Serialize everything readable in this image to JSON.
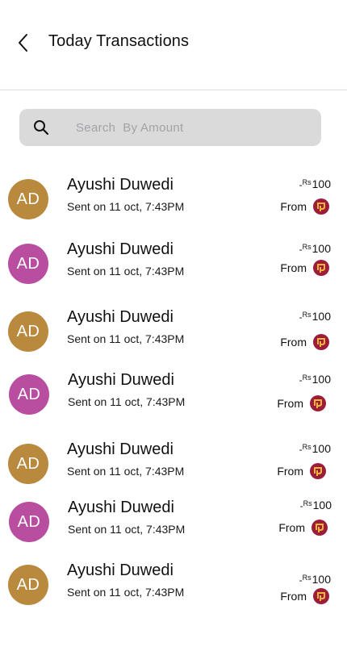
{
  "header": {
    "title": "Today Transactions"
  },
  "search": {
    "placeholder": "Search  By Amount"
  },
  "colors": {
    "avatar_gold": "#b98a3e",
    "avatar_magenta": "#b94ea1",
    "search_bg": "#dadada",
    "bank_logo_red": "#9c1d3a",
    "bank_logo_yellow": "#f0b43c"
  },
  "transactions": [
    {
      "initials": "AD",
      "name": "Ayushi Duwedi",
      "subtitle": "Sent on 11 oct, 7:43PM",
      "sign": "-",
      "currency": "Rs",
      "amount": "100",
      "from_label": "From",
      "avatar_color": "gold",
      "bank_icon": "bank-logo-icon"
    },
    {
      "initials": "AD",
      "name": "Ayushi Duwedi",
      "subtitle": "Sent on 11 oct, 7:43PM",
      "sign": "-",
      "currency": "Rs",
      "amount": "100",
      "from_label": "From",
      "avatar_color": "magenta",
      "bank_icon": "bank-logo-icon"
    },
    {
      "initials": "AD",
      "name": "Ayushi Duwedi",
      "subtitle": "Sent on 11 oct, 7:43PM",
      "sign": "-",
      "currency": "Rs",
      "amount": "100",
      "from_label": "From",
      "avatar_color": "gold",
      "bank_icon": "bank-logo-icon"
    },
    {
      "initials": "AD",
      "name": "Ayushi Duwedi",
      "subtitle": "Sent on 11 oct, 7:43PM",
      "sign": "-",
      "currency": "Rs",
      "amount": "100",
      "from_label": "From",
      "avatar_color": "magenta",
      "bank_icon": "bank-logo-icon"
    },
    {
      "initials": "AD",
      "name": "Ayushi Duwedi",
      "subtitle": "Sent on 11 oct, 7:43PM",
      "sign": "-",
      "currency": "Rs",
      "amount": "100",
      "from_label": "From",
      "avatar_color": "gold",
      "bank_icon": "bank-logo-icon"
    },
    {
      "initials": "AD",
      "name": "Ayushi Duwedi",
      "subtitle": "Sent on 11 oct, 7:43PM",
      "sign": "-",
      "currency": "Rs",
      "amount": "100",
      "from_label": "From",
      "avatar_color": "magenta",
      "bank_icon": "bank-logo-icon"
    },
    {
      "initials": "AD",
      "name": "Ayushi Duwedi",
      "subtitle": "Sent on 11 oct, 7:43PM",
      "sign": "-",
      "currency": "Rs",
      "amount": "100",
      "from_label": "From",
      "avatar_color": "gold",
      "bank_icon": "bank-logo-icon"
    }
  ]
}
